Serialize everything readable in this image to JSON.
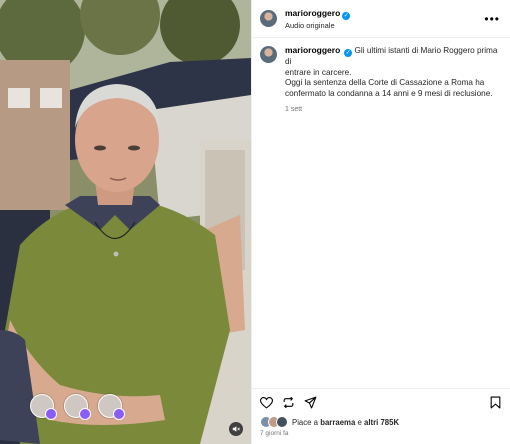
{
  "post": {
    "username": "marioroggero",
    "audio_label": "Audio originale",
    "caption_lines": [
      "Gli ultimi istanti di Mario Roggero prima di",
      "entrare in carcere.",
      "Oggi la sentenza della Corte di Cassazione a Roma ha",
      "confermato la condanna a 14 anni e 9 mesi di reclusione."
    ],
    "caption_time": "1 sett",
    "likes": {
      "prefix": "Piace a",
      "first_user": "barraema",
      "joiner": "e",
      "others": "altri 785K"
    },
    "posted_date": "7 giorni fa"
  },
  "icons": {
    "more": "more-options-icon",
    "verified": "verified-badge-icon",
    "like": "heart-icon",
    "repost": "repost-icon",
    "share": "share-icon",
    "save": "bookmark-icon",
    "mute": "muted-speaker-icon"
  },
  "colors": {
    "verified": "#0095f6",
    "secondary_text": "#737373",
    "divider": "#efefef",
    "shirt": "#7a8a3a"
  }
}
